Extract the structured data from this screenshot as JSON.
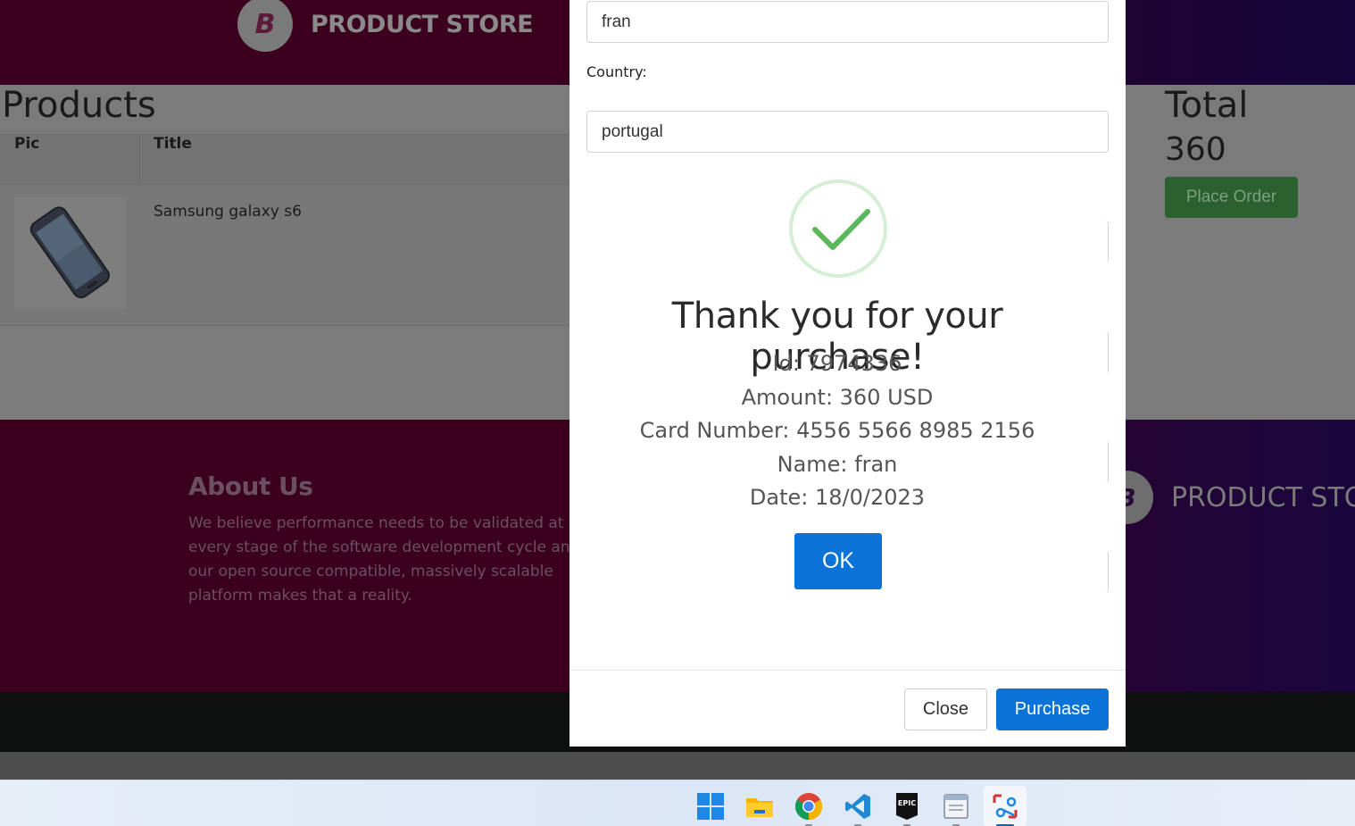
{
  "navbar": {
    "brand_letter": "B",
    "brand_text": "PRODUCT STORE"
  },
  "products": {
    "title": "Products",
    "columns": [
      "Pic",
      "Title"
    ],
    "rows": [
      {
        "title": "Samsung galaxy s6"
      }
    ]
  },
  "total": {
    "title": "Total",
    "value": "360",
    "place_order_label": "Place Order"
  },
  "footer": {
    "about_title": "About Us",
    "about_text": "We believe performance needs to be validated at every stage of the software development cycle and our open source compatible, massively scalable platform makes that a reality.",
    "brand_letter": "B",
    "brand_text": "PRODUCT STORE"
  },
  "modal": {
    "name_value": "fran",
    "country_label": "Country:",
    "country_value": "portugal",
    "close_label": "Close",
    "purchase_label": "Purchase"
  },
  "alert": {
    "title": "Thank you for your purchase!",
    "id_line": "Id: 7974336",
    "amount_line": "Amount: 360 USD",
    "card_line": "Card Number: 4556 5566 8985 2156",
    "name_line": "Name: fran",
    "date_line": "Date: 18/0/2023",
    "ok_label": "OK",
    "success_color": "#5cb85c"
  },
  "taskbar": {
    "icons": [
      "windows-start-icon",
      "file-explorer-icon",
      "chrome-icon",
      "vscode-icon",
      "epic-games-icon",
      "notepad-window-icon",
      "snipping-tool-icon"
    ],
    "epic_text": "EPIC"
  }
}
